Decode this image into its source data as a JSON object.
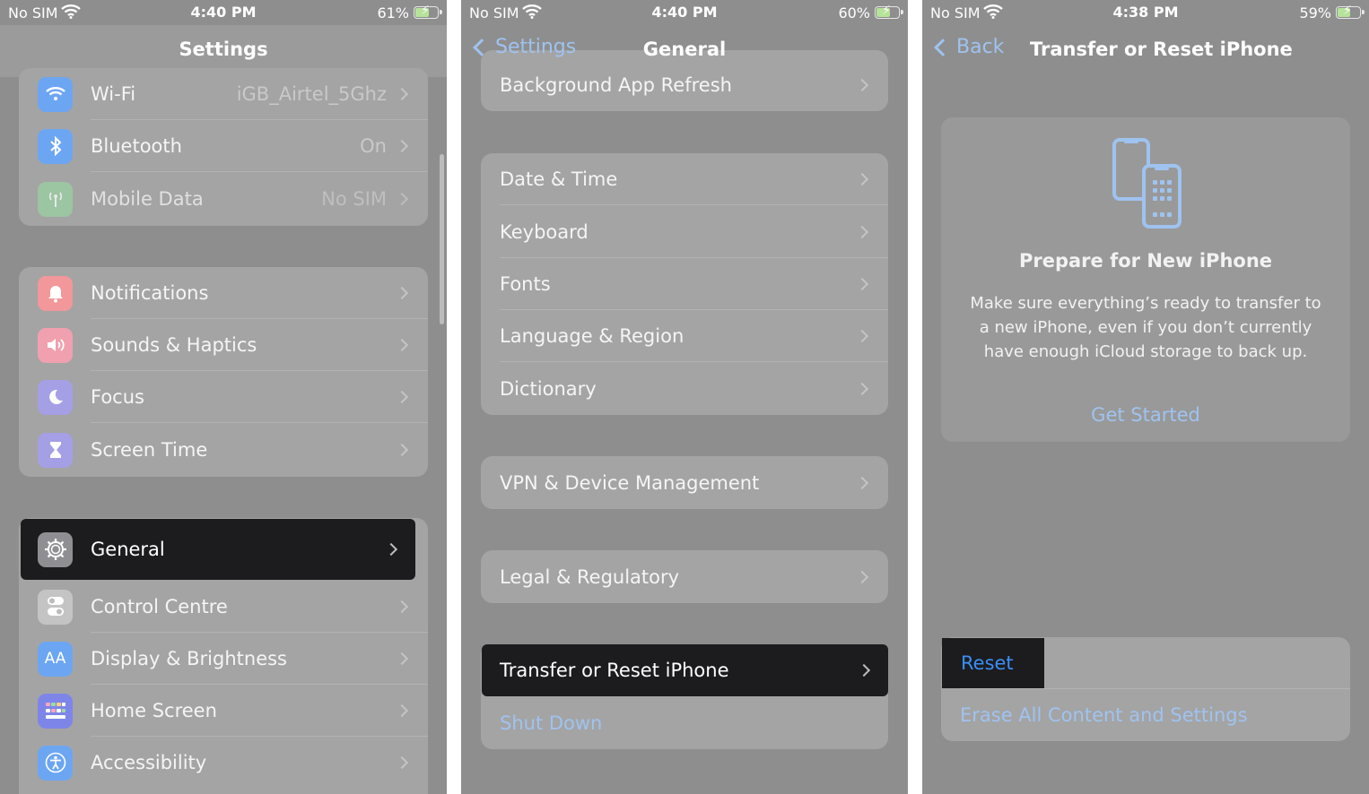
{
  "colors": {
    "link": "#9fc3f0",
    "reset_blue": "#3a8ef6",
    "highlight": "#1c1c1e"
  },
  "panel1": {
    "status": {
      "carrier": "No SIM",
      "time": "4:40 PM",
      "battery": "61%",
      "battery_level": 0.61
    },
    "title": "Settings",
    "items": [
      {
        "label": "Wi-Fi",
        "value": "iGB_Airtel_5Ghz",
        "icon": "wifi-icon"
      },
      {
        "label": "Bluetooth",
        "value": "On",
        "icon": "bluetooth-icon"
      },
      {
        "label": "Mobile Data",
        "value": "No SIM",
        "icon": "antenna-icon"
      },
      {
        "label": "Notifications",
        "icon": "bell-icon"
      },
      {
        "label": "Sounds & Haptics",
        "icon": "speaker-icon"
      },
      {
        "label": "Focus",
        "icon": "moon-icon"
      },
      {
        "label": "Screen Time",
        "icon": "hourglass-icon"
      },
      {
        "label": "General",
        "icon": "gear-icon"
      },
      {
        "label": "Control Centre",
        "icon": "toggles-icon"
      },
      {
        "label": "Display & Brightness",
        "icon": "text-size-icon"
      },
      {
        "label": "Home Screen",
        "icon": "app-grid-icon"
      },
      {
        "label": "Accessibility",
        "icon": "accessibility-icon"
      }
    ]
  },
  "panel2": {
    "status": {
      "carrier": "No SIM",
      "time": "4:40 PM",
      "battery": "60%",
      "battery_level": 0.6
    },
    "back": "Settings",
    "title": "General",
    "items": [
      "Background App Refresh",
      "Date & Time",
      "Keyboard",
      "Fonts",
      "Language & Region",
      "Dictionary",
      "VPN & Device Management",
      "Legal & Regulatory",
      "Transfer or Reset iPhone",
      "Shut Down"
    ]
  },
  "panel3": {
    "status": {
      "carrier": "No SIM",
      "time": "4:38 PM",
      "battery": "59%",
      "battery_level": 0.59
    },
    "back": "Back",
    "title": "Transfer or Reset iPhone",
    "card": {
      "title": "Prepare for New iPhone",
      "body": "Make sure everything’s ready to transfer to a new iPhone, even if you don’t currently have enough iCloud storage to back up.",
      "link": "Get Started"
    },
    "reset": "Reset",
    "erase": "Erase All Content and Settings"
  }
}
